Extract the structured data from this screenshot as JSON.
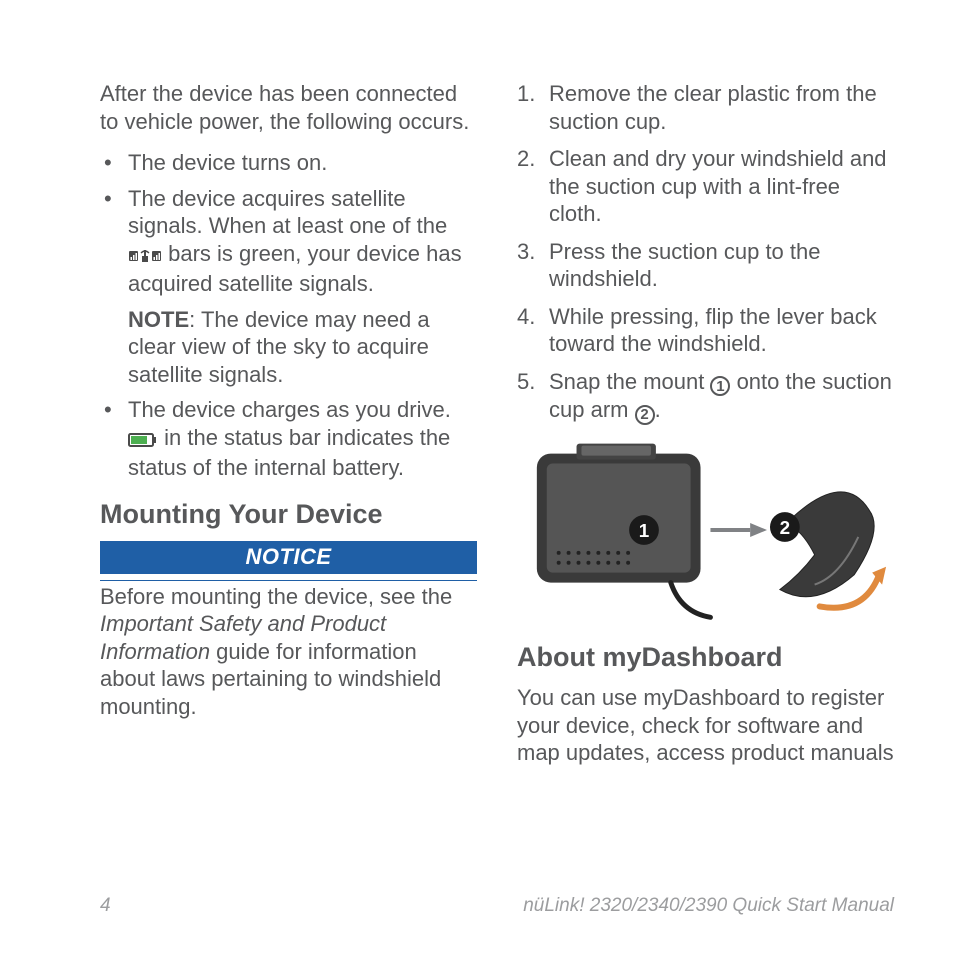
{
  "left": {
    "intro": "After the device has been connected to vehicle power, the following occurs.",
    "bullet1": "The device turns on.",
    "bullet2a": "The device acquires satellite signals. When at least one of the ",
    "bullet2b": " bars is green, your device has acquired satellite signals.",
    "note_label": "NOTE",
    "note_text": ": The device may need a clear view of the sky to acquire satellite signals.",
    "bullet3a": "The device charges as you drive. ",
    "bullet3b": " in the status bar indicates the status of the internal battery.",
    "heading_mount": "Mounting Your Device",
    "notice_label": "NOTICE",
    "notice_body_a": "Before mounting the device, see the ",
    "notice_body_italic": "Important Safety and Product Information",
    "notice_body_b": " guide for information about laws pertaining to windshield mounting."
  },
  "right": {
    "step1": "Remove the clear plastic from the suction cup.",
    "step2": "Clean and dry your windshield and the suction cup with a lint-free cloth.",
    "step3": "Press the suction cup to the windshield.",
    "step4": "While pressing, flip the lever back toward the windshield.",
    "step5a": "Snap the mount ",
    "step5b": " onto the suction cup arm ",
    "step5c": ".",
    "callout1": "1",
    "callout2": "2",
    "heading_dash": "About myDashboard",
    "dash_body": "You can use myDashboard to register your device, check for software and map updates, access product manuals"
  },
  "footer": {
    "page": "4",
    "title": "nüLink! 2320/2340/2390 Quick Start Manual"
  }
}
